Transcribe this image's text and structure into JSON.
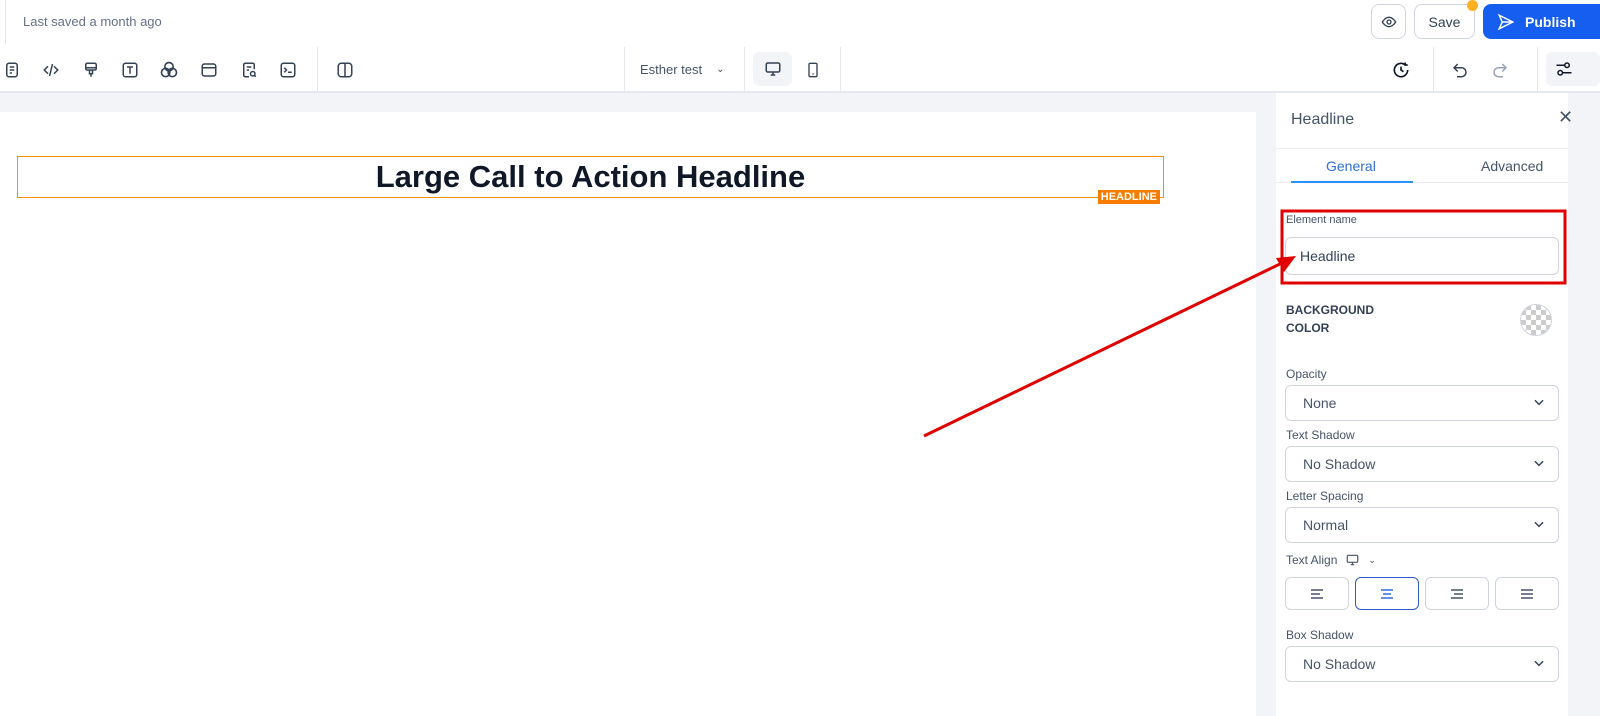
{
  "topbar": {
    "saved_text": "Last saved a month ago",
    "save_label": "Save",
    "publish_label": "Publish"
  },
  "toolbar": {
    "page_selector": "Esther test"
  },
  "canvas": {
    "headline_text": "Large Call to Action Headline",
    "element_tag": "HEADLINE"
  },
  "panel": {
    "title": "Headline",
    "tabs": [
      "General",
      "Advanced"
    ],
    "element_name_label": "Element name",
    "element_name_value": "Headline",
    "bg_color_label_1": "BACKGROUND",
    "bg_color_label_2": "COLOR",
    "opacity_label": "Opacity",
    "opacity_value": "None",
    "text_shadow_label": "Text Shadow",
    "text_shadow_value": "No Shadow",
    "letter_spacing_label": "Letter Spacing",
    "letter_spacing_value": "Normal",
    "text_align_label": "Text Align",
    "text_align_selected": "center",
    "box_shadow_label": "Box Shadow",
    "box_shadow_value": "No Shadow"
  },
  "colors": {
    "accent": "#155eef",
    "highlight": "#f57c00",
    "annotation": "#e00000"
  }
}
